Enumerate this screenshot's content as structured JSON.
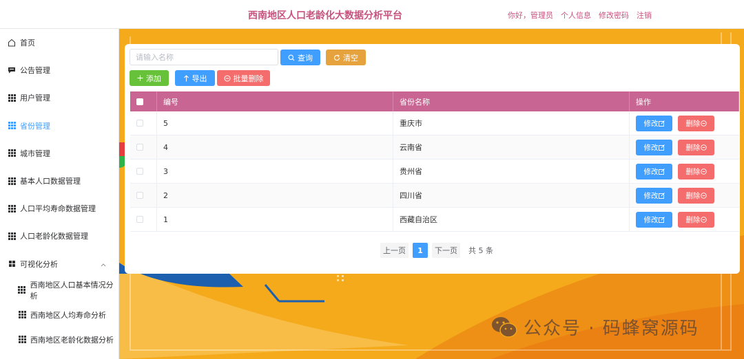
{
  "header": {
    "title": "西南地区人口老龄化大数据分析平台",
    "greeting": "你好，管理员",
    "profile": "个人信息",
    "change_password": "修改密码",
    "logout": "注销"
  },
  "sidebar": {
    "items": [
      {
        "label": "首页",
        "icon": "home-icon"
      },
      {
        "label": "公告管理",
        "icon": "chat-icon"
      },
      {
        "label": "用户管理",
        "icon": "grid-icon"
      },
      {
        "label": "省份管理",
        "icon": "grid-icon",
        "active": true
      },
      {
        "label": "城市管理",
        "icon": "grid-icon"
      },
      {
        "label": "基本人口数据管理",
        "icon": "grid-icon"
      },
      {
        "label": "人口平均寿命数据管理",
        "icon": "grid-icon"
      },
      {
        "label": "人口老龄化数据管理",
        "icon": "grid-icon"
      },
      {
        "label": "可视化分析",
        "icon": "grid4-icon",
        "expanded": true
      }
    ],
    "subitems": [
      {
        "label": "西南地区人口基本情况分析"
      },
      {
        "label": "西南地区人均寿命分析"
      },
      {
        "label": "西南地区老龄化数据分析"
      }
    ]
  },
  "toolbar": {
    "search_placeholder": "请输入名称",
    "search_value": "",
    "query_label": "查询",
    "clear_label": "清空",
    "add_label": "添加",
    "export_label": "导出",
    "batch_delete_label": "批量删除"
  },
  "table": {
    "columns": [
      "编号",
      "省份名称",
      "操作"
    ],
    "rows": [
      {
        "id": "5",
        "name": "重庆市"
      },
      {
        "id": "4",
        "name": "云南省"
      },
      {
        "id": "3",
        "name": "贵州省"
      },
      {
        "id": "2",
        "name": "四川省"
      },
      {
        "id": "1",
        "name": "西藏自治区"
      }
    ],
    "edit_label": "修改",
    "delete_label": "删除"
  },
  "pagination": {
    "prev_label": "上一页",
    "current_page": "1",
    "next_label": "下一页",
    "total_label": "共 5 条"
  },
  "watermark": {
    "text": "公众号 · 码蜂窝源码"
  },
  "colors": {
    "brand": "#c86592",
    "primary": "#409eff",
    "success": "#67c23a",
    "warning": "#e6a23c",
    "danger": "#f56c6c",
    "background": "#f5a81e"
  }
}
